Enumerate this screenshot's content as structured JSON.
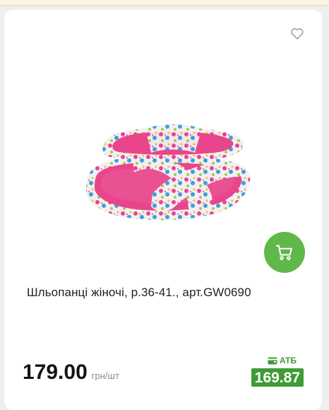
{
  "card": {
    "title": "Шльопанці жіночі, р.36-41., арт.GW0690",
    "price": "179.00",
    "unit": "грн/шт",
    "promo_label": "АТБ",
    "promo_price": "169.87"
  },
  "icons": {
    "favorite": "heart-outline-icon",
    "cart": "cart-icon",
    "promo": "wallet-icon"
  },
  "colors": {
    "accent_green": "#5eb84a",
    "promo_green": "#3f9b35",
    "slipper_pink": "#e8458c"
  }
}
